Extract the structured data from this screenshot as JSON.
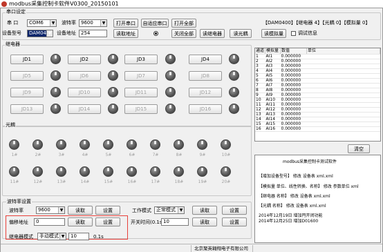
{
  "window": {
    "title": "modbus采集控制卡软件V0300_20150101",
    "icon": "app-icon"
  },
  "serial": {
    "group_label": "串口设定",
    "port_label": "串 口",
    "port_value": "COM6",
    "baud_label": "波特率",
    "baud_value": "9600",
    "open_port": "打开串口",
    "auto_port": "自适应串口",
    "open_all": "打开全部",
    "model_label": "设备型号",
    "model_value": "DAM0400",
    "addr_label": "设备地址",
    "addr_value": "254",
    "read_addr": "读取地址",
    "close_all": "关闭全部",
    "read_relay": "读继电器",
    "read_optocoupler": "读光耦",
    "read_analog": "读模拟量",
    "debug_label": "调试信息",
    "summary": "【DAM0400】【继电器 4】【光耦 0】【模拟量 0】"
  },
  "relay": {
    "group_label": "继电器",
    "buttons": [
      "JD1",
      "JD2",
      "JD3",
      "JD4",
      "JD5",
      "JD6",
      "JD7",
      "JD8",
      "JD9",
      "JD10",
      "JD11",
      "JD12",
      "JD13",
      "JD14",
      "JD15",
      "JD16"
    ]
  },
  "optocoupler": {
    "group_label": "光耦",
    "labels": [
      "1#",
      "2#",
      "3#",
      "4#",
      "5#",
      "6#",
      "7#",
      "8#",
      "9#",
      "10#",
      "11#",
      "12#",
      "13#",
      "14#",
      "15#",
      "16#",
      "17#",
      "18#",
      "19#",
      "20#"
    ]
  },
  "table": {
    "headers": [
      "通道",
      "模拟量",
      "数值",
      "单位"
    ],
    "rows": [
      {
        "ch": "1",
        "name": "AI1",
        "val": "0.000000"
      },
      {
        "ch": "2",
        "name": "AI2",
        "val": "0.000000"
      },
      {
        "ch": "3",
        "name": "AI3",
        "val": "0.000000"
      },
      {
        "ch": "4",
        "name": "AI4",
        "val": "0.000000"
      },
      {
        "ch": "5",
        "name": "AI5",
        "val": "0.000000"
      },
      {
        "ch": "6",
        "name": "AI6",
        "val": "0.000000"
      },
      {
        "ch": "7",
        "name": "AI7",
        "val": "0.000000"
      },
      {
        "ch": "8",
        "name": "AI8",
        "val": "0.000000"
      },
      {
        "ch": "9",
        "name": "AI9",
        "val": "0.000000"
      },
      {
        "ch": "10",
        "name": "AI10",
        "val": "0.000000"
      },
      {
        "ch": "11",
        "name": "AI11",
        "val": "0.000000"
      },
      {
        "ch": "12",
        "name": "AI12",
        "val": "0.000000"
      },
      {
        "ch": "13",
        "name": "AI13",
        "val": "0.000000"
      },
      {
        "ch": "14",
        "name": "AI14",
        "val": "0.000000"
      },
      {
        "ch": "15",
        "name": "AI15",
        "val": "0.000000"
      },
      {
        "ch": "16",
        "name": "AI16",
        "val": "0.000000"
      }
    ]
  },
  "clear_button": "清空",
  "log": {
    "title": "modbus采集控制卡测试软件",
    "lines": [
      "【增加设备型号】 修改  设备表 xml.xml",
      "【模拟量 单位、线性转换、名称】 修改 参数单位 xml",
      "【继电器 名称】 修改  设备表 xml.xml",
      "【光耦 名称】 修改  设备表 xml.xml",
      "2014年12月19日  增加円开闭功能",
      "2014年12月25日  增加D01600"
    ]
  },
  "baud_settings": {
    "group_label": "波特率设置",
    "baud_label": "波特率",
    "baud_value": "9600",
    "read": "读取",
    "set": "设置",
    "offset_label": "偏移地址",
    "offset_value": "0",
    "read2": "读取",
    "set2": "设置",
    "relay_mode_label": "继电器模式",
    "relay_mode_value": "手动模式",
    "relay_mode_extra": "10",
    "relay_mode_unit": "0.1s"
  },
  "work": {
    "mode_label": "工作模式",
    "mode_value": "正常模式",
    "read": "读取",
    "set": "设置",
    "time_label": "开关时间(0.1s)",
    "time_value": "10",
    "read2": "读取",
    "set2": "设置"
  },
  "status": {
    "company": "北京聚英翱翔电子有限公司"
  }
}
